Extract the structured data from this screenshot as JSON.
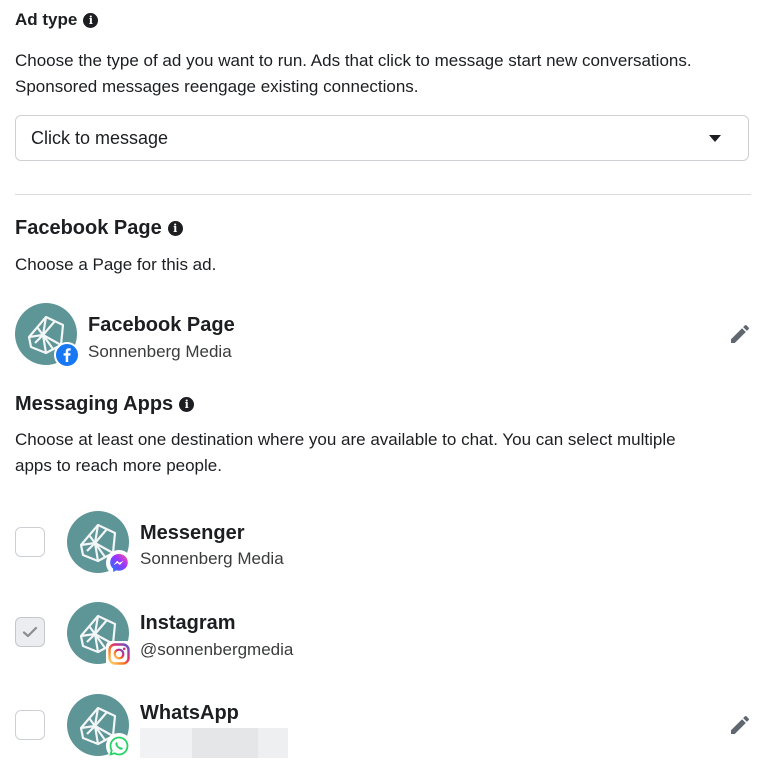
{
  "ad_type": {
    "title": "Ad type",
    "description_line1": "Choose the type of ad you want to run. Ads that click to message start new conversations.",
    "description_line2": "Sponsored messages reengage existing connections.",
    "selected": "Click to message"
  },
  "facebook_page": {
    "title": "Facebook Page",
    "description": "Choose a Page for this ad.",
    "item": {
      "name": "Facebook Page",
      "subtitle": "Sonnenberg Media"
    }
  },
  "messaging_apps": {
    "title": "Messaging Apps",
    "description_line1": "Choose at least one destination where you are available to chat. You can select multiple",
    "description_line2": "apps to reach more people.",
    "items": [
      {
        "name": "Messenger",
        "subtitle": "Sonnenberg Media",
        "checked": false,
        "badge_icon": "messenger-icon"
      },
      {
        "name": "Instagram",
        "subtitle": "@sonnenbergmedia",
        "checked": true,
        "badge_icon": "instagram-icon"
      },
      {
        "name": "WhatsApp",
        "subtitle": "",
        "checked": false,
        "badge_icon": "whatsapp-icon"
      }
    ]
  },
  "colors": {
    "avatar": "#5e9597",
    "facebook": "#1877f2",
    "whatsapp": "#25d366"
  }
}
